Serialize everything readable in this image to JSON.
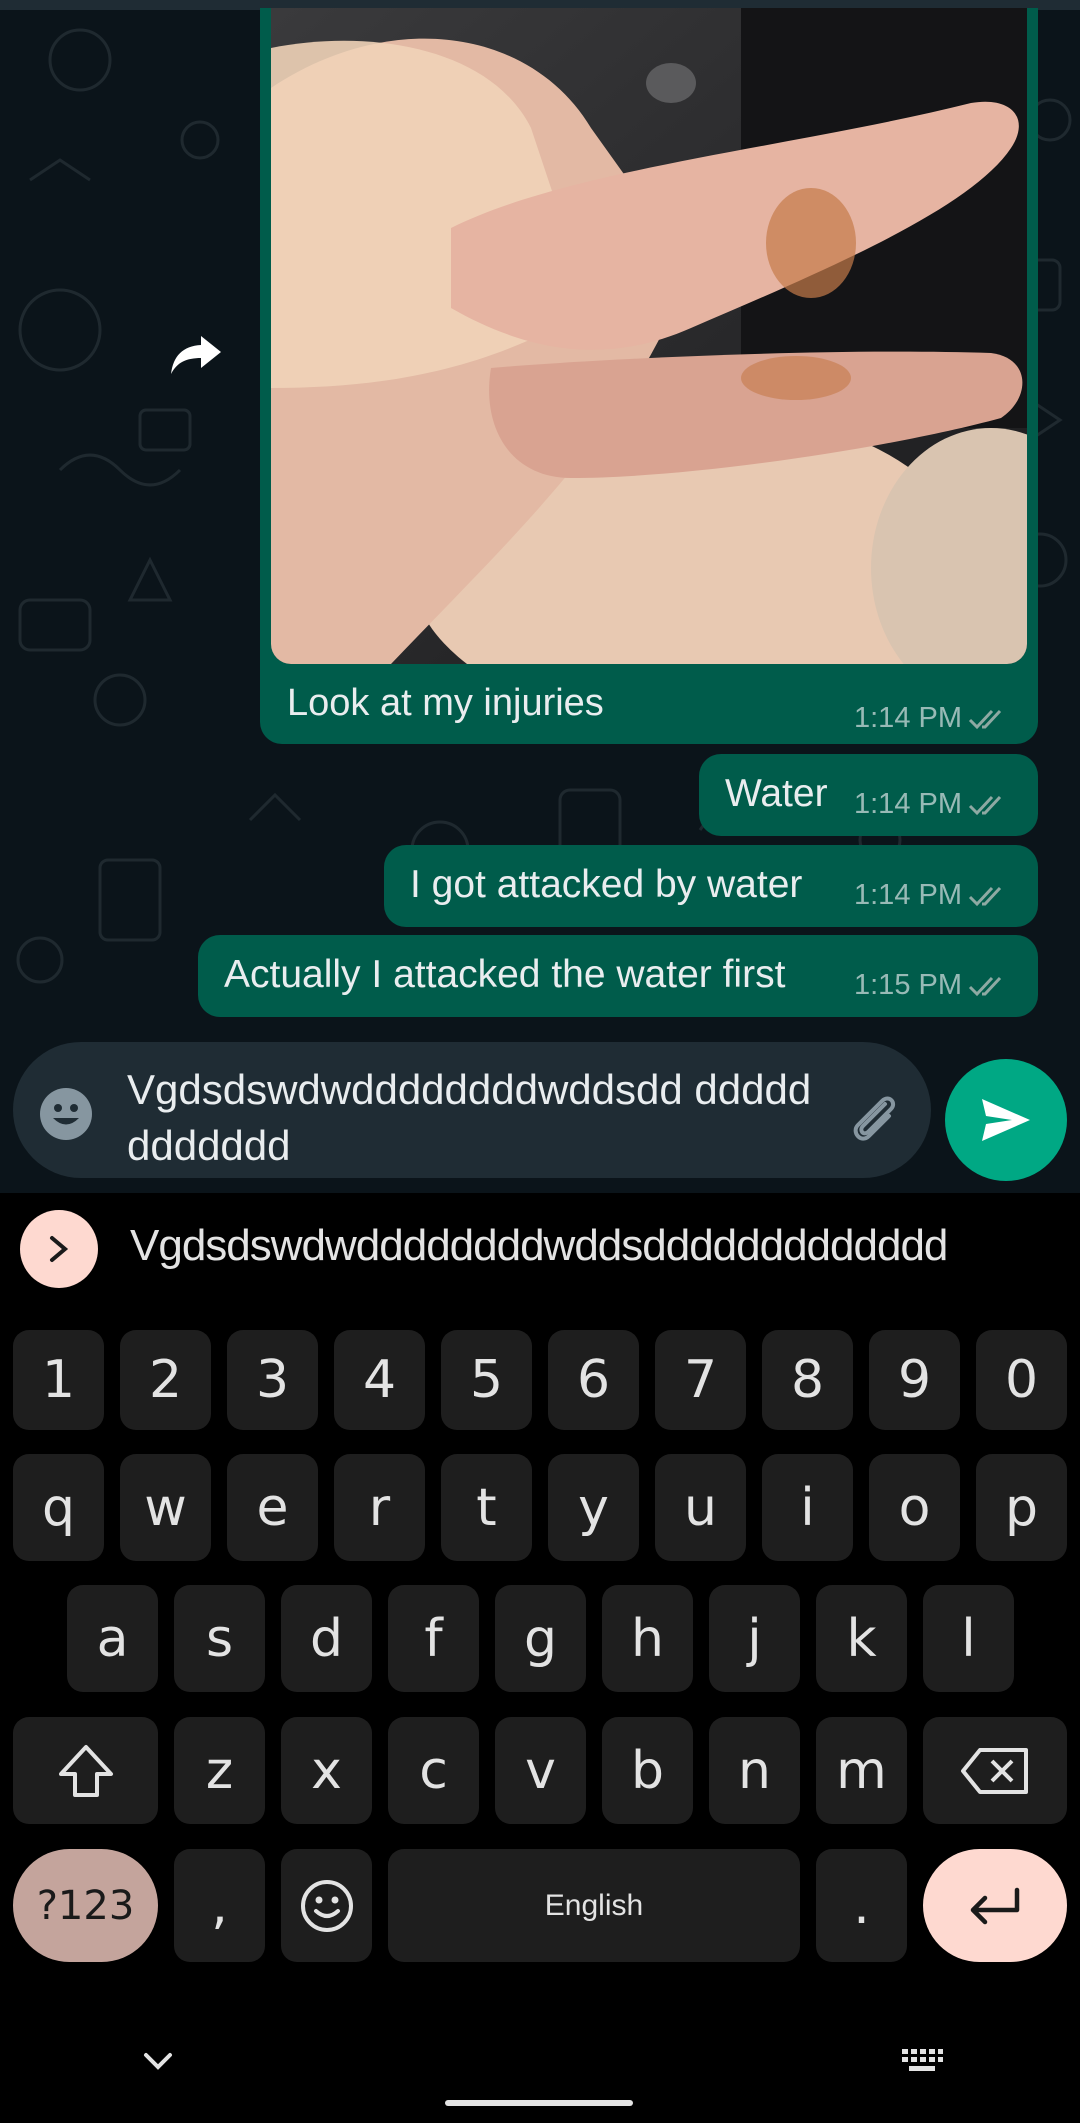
{
  "chat": {
    "image_caption": "Look at my injuries",
    "image_time": "1:14 PM",
    "messages": [
      {
        "text": "Water",
        "time": "1:14 PM"
      },
      {
        "text": "I got attacked by water",
        "time": "1:14 PM"
      },
      {
        "text": "Actually I attacked the water first",
        "time": "1:15 PM"
      }
    ],
    "forward_icon": "forward-arrow-icon",
    "tick_icon": "double-check-icon"
  },
  "composer": {
    "text": "Vgdsdswdwddddddddwddsdd dddddddddddd",
    "emoji_icon": "emoji-icon",
    "attach_icon": "paperclip-icon",
    "send_icon": "send-icon"
  },
  "keyboard": {
    "suggestion": "Vgdsdswdwddddddddwddsddddddddddddd",
    "row_numbers": [
      "1",
      "2",
      "3",
      "4",
      "5",
      "6",
      "7",
      "8",
      "9",
      "0"
    ],
    "row1": [
      "q",
      "w",
      "e",
      "r",
      "t",
      "y",
      "u",
      "i",
      "o",
      "p"
    ],
    "row2": [
      "a",
      "s",
      "d",
      "f",
      "g",
      "h",
      "j",
      "k",
      "l"
    ],
    "row3": [
      "z",
      "x",
      "c",
      "v",
      "b",
      "n",
      "m"
    ],
    "symbols_label": "?123",
    "comma": ",",
    "space_label": "English",
    "period": ".",
    "colors": {
      "accent": "#fed9d0",
      "symbols": "#c4a49c",
      "key": "#1e1e1e"
    }
  }
}
